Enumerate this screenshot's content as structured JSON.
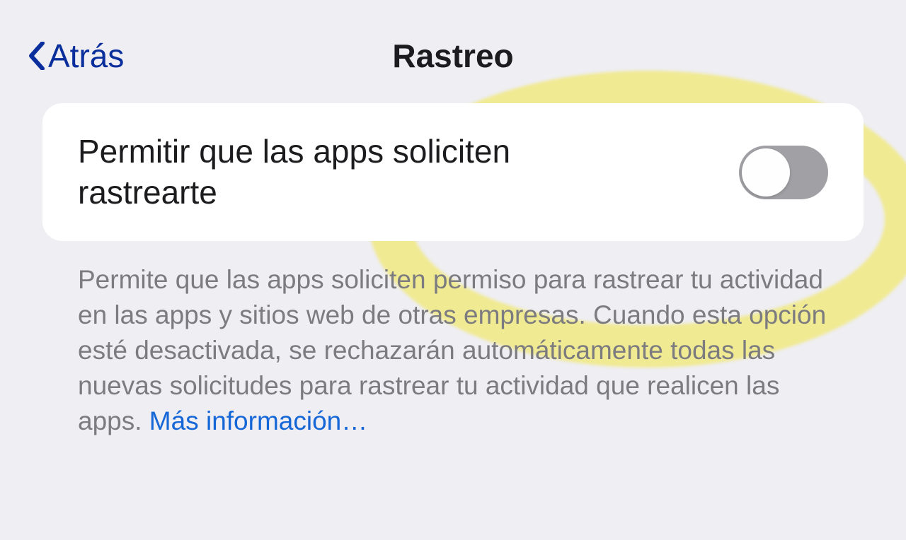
{
  "header": {
    "back_label": "Atrás",
    "title": "Rastreo"
  },
  "setting": {
    "label": "Permitir que las apps soliciten rastrearte",
    "toggle_on": false
  },
  "description": {
    "text": "Permite que las apps soliciten permiso para rastrear tu actividad en las apps y sitios web de otras empresas. Cuando esta opción esté desactivada, se rechazarán automáticamente todas las nuevas solicitudes para rastrear tu actividad que realicen las apps. ",
    "link_text": "Más información…"
  }
}
